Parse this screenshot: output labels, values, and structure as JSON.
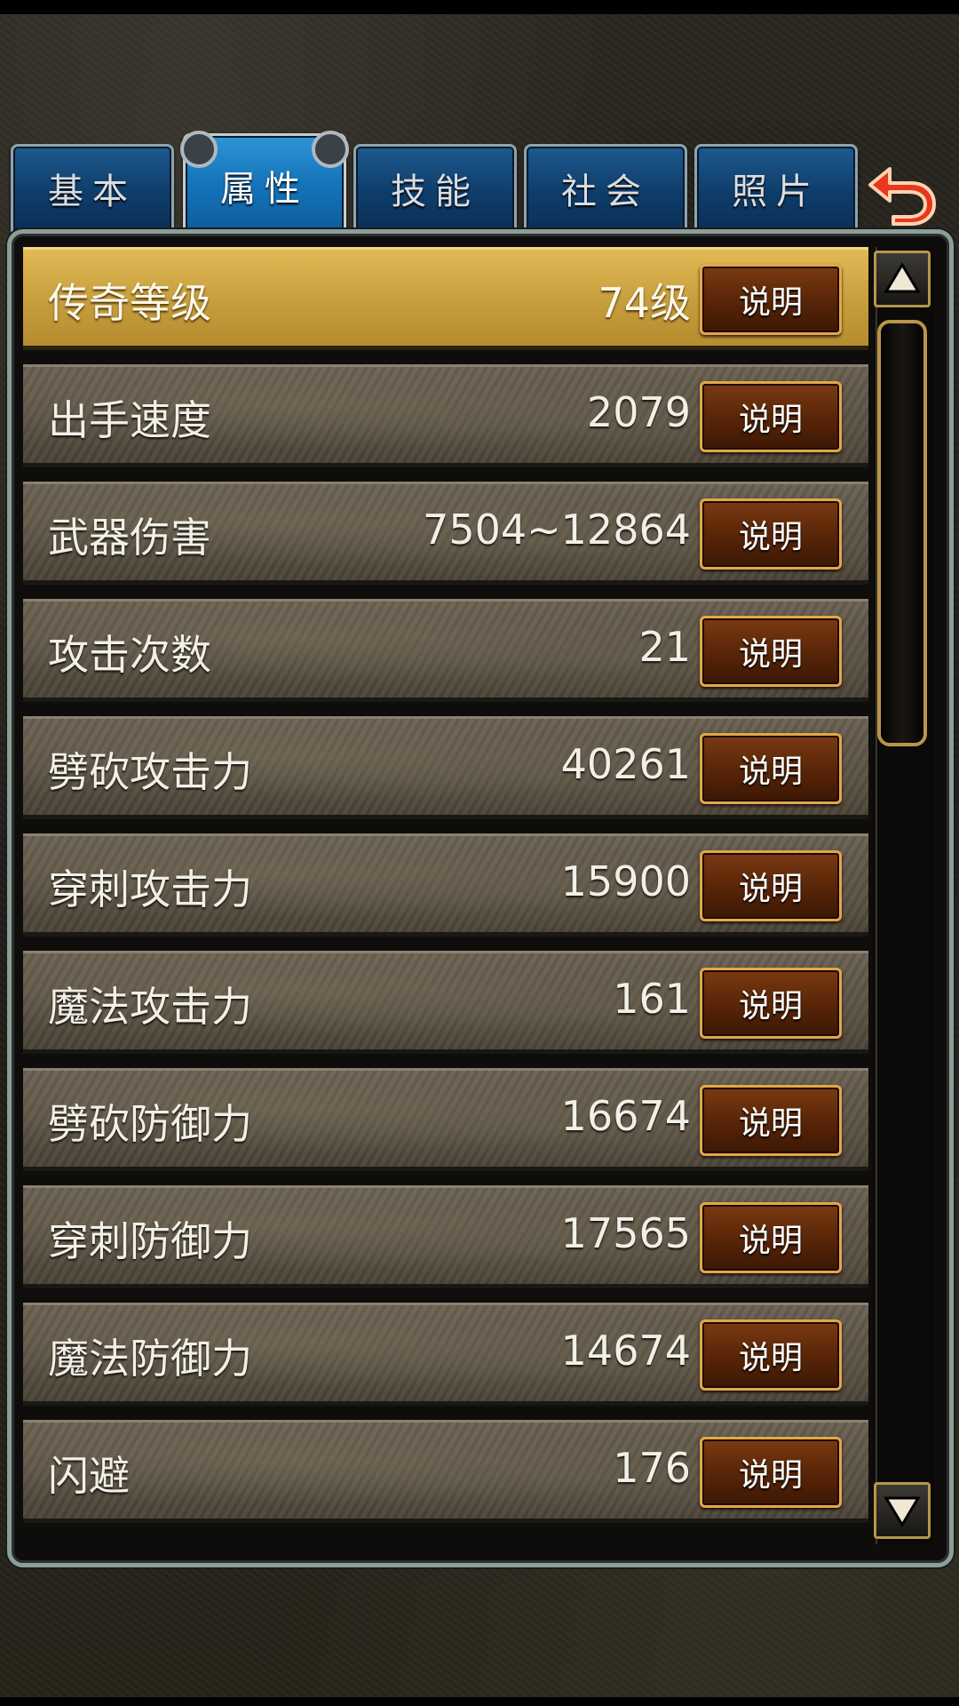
{
  "tabs": [
    {
      "label": "基本",
      "active": false
    },
    {
      "label": "属性",
      "active": true
    },
    {
      "label": "技能",
      "active": false
    },
    {
      "label": "社会",
      "active": false
    },
    {
      "label": "照片",
      "active": false
    }
  ],
  "back_icon": "undo-arrow-icon",
  "info_button_label": "说明",
  "attributes": [
    {
      "label": "传奇等级",
      "value": "74级",
      "selected": true
    },
    {
      "label": "出手速度",
      "value": "2079"
    },
    {
      "label": "武器伤害",
      "value": "7504~12864"
    },
    {
      "label": "攻击次数",
      "value": "21"
    },
    {
      "label": "劈砍攻击力",
      "value": "40261"
    },
    {
      "label": "穿刺攻击力",
      "value": "15900"
    },
    {
      "label": "魔法攻击力",
      "value": "161"
    },
    {
      "label": "劈砍防御力",
      "value": "16674"
    },
    {
      "label": "穿刺防御力",
      "value": "17565"
    },
    {
      "label": "魔法防御力",
      "value": "14674"
    },
    {
      "label": "闪避",
      "value": "176"
    }
  ],
  "scrollbar": {
    "up_icon": "scroll-up-arrow-icon",
    "down_icon": "scroll-down-arrow-icon",
    "position_fraction": 0.0
  },
  "colors": {
    "tab_blue": "#0f3d6b",
    "tab_active_blue": "#1676bd",
    "selected_row_gold": "#c9a03f",
    "info_button_brown": "#5a2608",
    "accent_gold": "#b79649"
  }
}
